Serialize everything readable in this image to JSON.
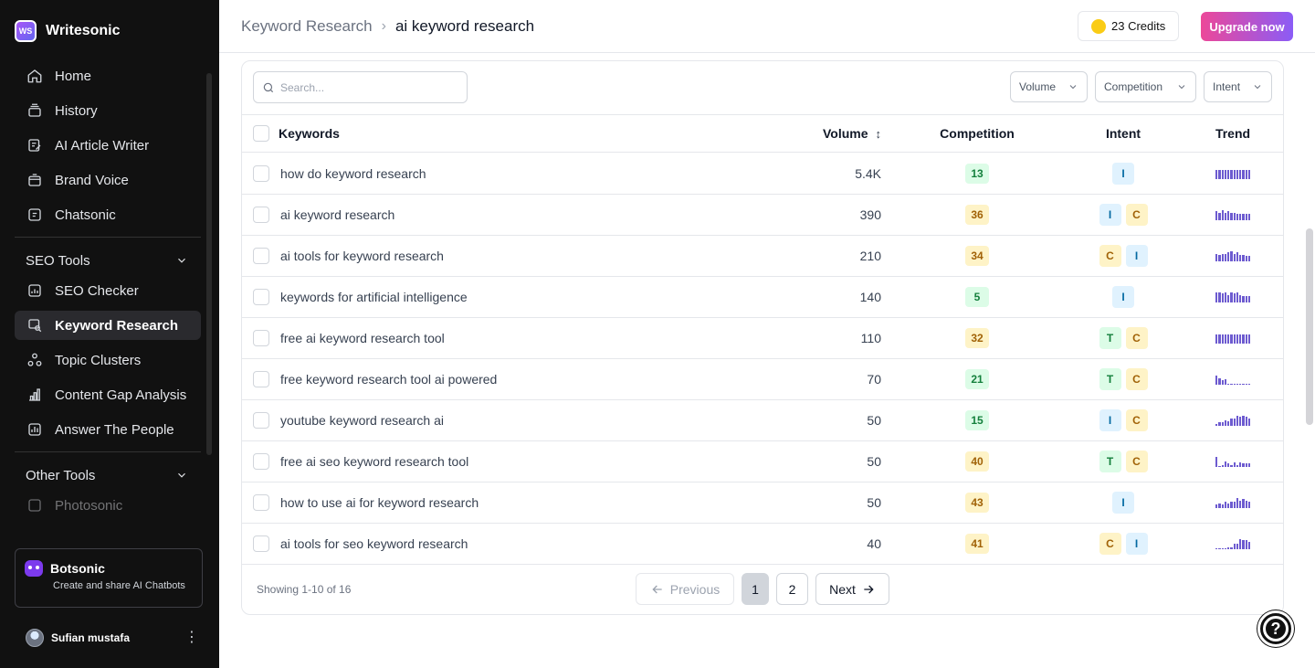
{
  "brand": {
    "name": "Writesonic",
    "logo_text": "WS"
  },
  "sidebar": {
    "items": [
      {
        "label": "Home",
        "icon": "home-icon"
      },
      {
        "label": "History",
        "icon": "history-icon"
      },
      {
        "label": "AI Article Writer",
        "icon": "article-icon"
      },
      {
        "label": "Brand Voice",
        "icon": "brand-voice-icon"
      },
      {
        "label": "Chatsonic",
        "icon": "chatsonic-icon"
      }
    ],
    "seo_section": "SEO Tools",
    "seo_items": [
      {
        "label": "SEO Checker",
        "icon": "seo-checker-icon"
      },
      {
        "label": "Keyword Research",
        "icon": "keyword-research-icon",
        "active": true
      },
      {
        "label": "Topic Clusters",
        "icon": "topic-clusters-icon"
      },
      {
        "label": "Content Gap Analysis",
        "icon": "bar-chart-icon"
      },
      {
        "label": "Answer The People",
        "icon": "answer-people-icon"
      }
    ],
    "other_section": "Other Tools",
    "other_items": [
      {
        "label": "Photosonic",
        "icon": "photosonic-icon"
      }
    ],
    "bot_card": {
      "title": "Botsonic",
      "subtitle": "Create and share AI Chatbots"
    },
    "user": {
      "name": "Sufian mustafa"
    }
  },
  "header": {
    "breadcrumb_parent": "Keyword Research",
    "breadcrumb_current": "ai keyword research",
    "credits": "23 Credits",
    "upgrade": "Upgrade now"
  },
  "toolbar": {
    "search_placeholder": "Search...",
    "filters": [
      "Volume",
      "Competition",
      "Intent"
    ]
  },
  "table": {
    "columns": {
      "keywords": "Keywords",
      "volume": "Volume",
      "competition": "Competition",
      "intent": "Intent",
      "trend": "Trend"
    },
    "rows": [
      {
        "keyword": "how do keyword research",
        "volume": "5.4K",
        "competition": "13",
        "intent": [
          "I"
        ],
        "trend": [
          0.8,
          0.8,
          0.8,
          0.8,
          0.8,
          0.8,
          0.8,
          0.8,
          0.8,
          0.8,
          0.8,
          0.8
        ]
      },
      {
        "keyword": "ai keyword research",
        "volume": "390",
        "competition": "36",
        "intent": [
          "I",
          "C"
        ],
        "trend": [
          0.8,
          0.7,
          0.9,
          0.7,
          0.8,
          0.7,
          0.7,
          0.6,
          0.6,
          0.6,
          0.6,
          0.6
        ]
      },
      {
        "keyword": "ai tools for keyword research",
        "volume": "210",
        "competition": "34",
        "intent": [
          "C",
          "I"
        ],
        "trend": [
          0.7,
          0.6,
          0.7,
          0.7,
          0.8,
          0.9,
          0.7,
          0.8,
          0.6,
          0.6,
          0.5,
          0.5
        ]
      },
      {
        "keyword": "keywords for artificial intelligence",
        "volume": "140",
        "competition": "5",
        "intent": [
          "I"
        ],
        "trend": [
          0.9,
          0.9,
          0.8,
          0.9,
          0.7,
          0.9,
          0.8,
          0.9,
          0.7,
          0.6,
          0.6,
          0.6
        ]
      },
      {
        "keyword": "free ai keyword research tool",
        "volume": "110",
        "competition": "32",
        "intent": [
          "T",
          "C"
        ],
        "trend": [
          0.8,
          0.8,
          0.8,
          0.8,
          0.8,
          0.8,
          0.8,
          0.8,
          0.8,
          0.8,
          0.8,
          0.8
        ]
      },
      {
        "keyword": "free keyword research tool ai powered",
        "volume": "70",
        "competition": "21",
        "intent": [
          "T",
          "C"
        ],
        "trend": [
          0.8,
          0.6,
          0.4,
          0.5,
          0.1,
          0.1,
          0.1,
          0.1,
          0.1,
          0.1,
          0.1,
          0.1
        ]
      },
      {
        "keyword": "youtube keyword research ai",
        "volume": "50",
        "competition": "15",
        "intent": [
          "I",
          "C"
        ],
        "trend": [
          0.2,
          0.3,
          0.3,
          0.5,
          0.4,
          0.7,
          0.7,
          0.9,
          0.8,
          0.9,
          0.8,
          0.7
        ]
      },
      {
        "keyword": "free ai seo keyword research tool",
        "volume": "50",
        "competition": "40",
        "intent": [
          "T",
          "C"
        ],
        "trend": [
          0.9,
          0.1,
          0.2,
          0.5,
          0.3,
          0.2,
          0.4,
          0.2,
          0.4,
          0.3,
          0.3,
          0.3
        ]
      },
      {
        "keyword": "how to use ai for keyword research",
        "volume": "50",
        "competition": "43",
        "intent": [
          "I"
        ],
        "trend": [
          0.3,
          0.4,
          0.3,
          0.6,
          0.4,
          0.6,
          0.6,
          0.9,
          0.7,
          0.8,
          0.7,
          0.6
        ]
      },
      {
        "keyword": "ai tools for seo keyword research",
        "volume": "40",
        "competition": "41",
        "intent": [
          "C",
          "I"
        ],
        "trend": [
          0.1,
          0.1,
          0.1,
          0.1,
          0.2,
          0.2,
          0.5,
          0.5,
          0.9,
          0.8,
          0.8,
          0.7
        ]
      }
    ]
  },
  "pagination": {
    "showing": "Showing 1-10 of 16",
    "previous": "Previous",
    "pages": [
      "1",
      "2"
    ],
    "next": "Next"
  },
  "colors": {
    "sidebar_bg": "#111111",
    "trend_bar": "#6d5bd0",
    "accent_start": "#ec4899",
    "accent_end": "#8b5cf6"
  }
}
